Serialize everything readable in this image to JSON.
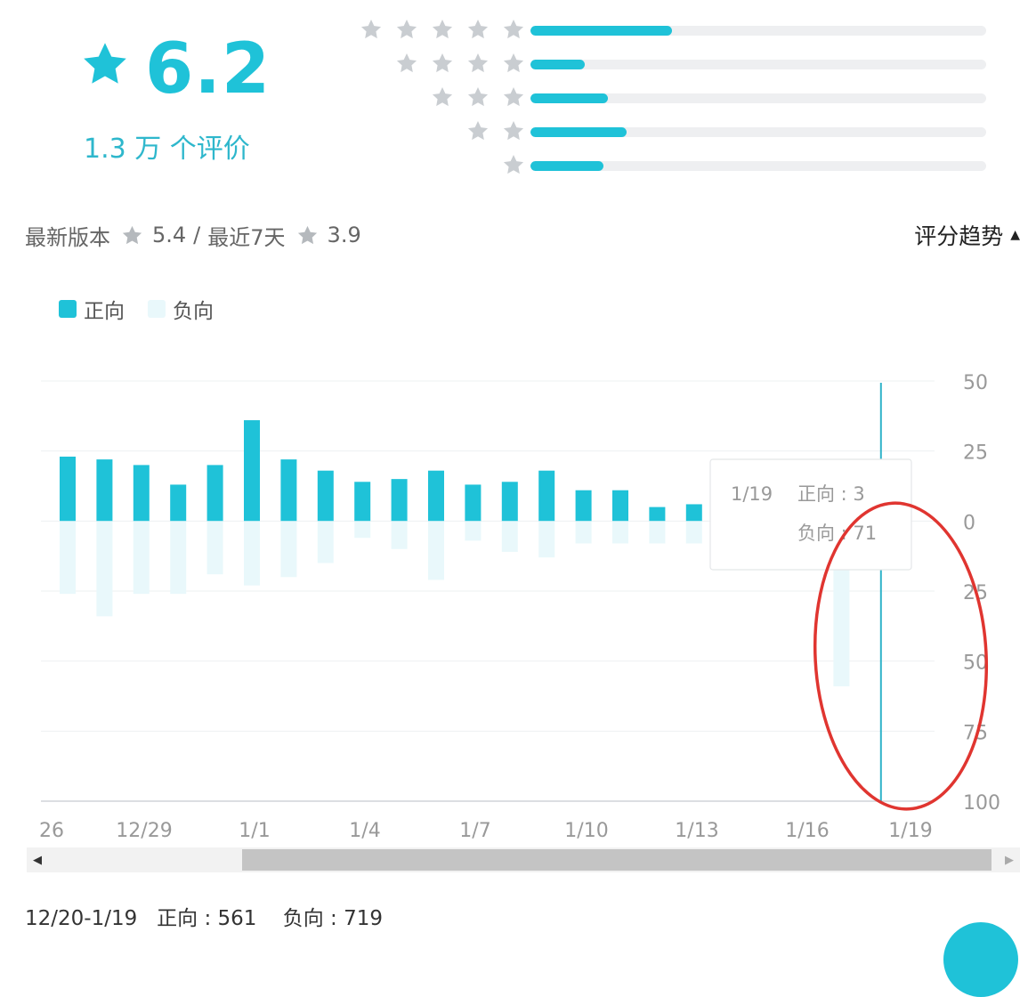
{
  "rating": {
    "score": "6.2",
    "review_count": "1.3 万 个评价",
    "distribution": [
      {
        "stars": 5,
        "fraction": 0.31
      },
      {
        "stars": 4,
        "fraction": 0.12
      },
      {
        "stars": 3,
        "fraction": 0.17
      },
      {
        "stars": 2,
        "fraction": 0.21
      },
      {
        "stars": 1,
        "fraction": 0.16
      }
    ]
  },
  "colors": {
    "accent": "#1fc2d8",
    "negative": "#e9f8fb",
    "star_gray": "#c9cdd1",
    "track": "#eeeff1",
    "annotation": "#e03530"
  },
  "version_info": {
    "latest_label": "最新版本",
    "latest_score": "5.4",
    "separator": "/",
    "recent_label": "最近7天",
    "recent_score": "3.9"
  },
  "trend_toggle": {
    "label": "评分趋势",
    "icon": "caret-up-icon"
  },
  "legend": {
    "positive": "正向",
    "negative": "负向"
  },
  "chart_data": {
    "type": "bar",
    "x_tick_labels": [
      "26",
      "12/29",
      "1/1",
      "1/4",
      "1/7",
      "1/10",
      "1/13",
      "1/16",
      "1/19"
    ],
    "y_tick_labels": [
      "50",
      "25",
      "0",
      "25",
      "50",
      "75",
      "100"
    ],
    "ylim": [
      -100,
      50
    ],
    "series": [
      {
        "name": "正向",
        "values": [
          23,
          22,
          20,
          13,
          20,
          36,
          22,
          18,
          14,
          15,
          18,
          13,
          14,
          18,
          11,
          11,
          5,
          6,
          null,
          null,
          null,
          null,
          3
        ]
      },
      {
        "name": "负向",
        "values": [
          26,
          34,
          26,
          26,
          19,
          23,
          20,
          15,
          6,
          10,
          21,
          7,
          11,
          13,
          8,
          8,
          8,
          8,
          null,
          null,
          null,
          59,
          71
        ]
      }
    ],
    "tooltip": {
      "date": "1/19",
      "positive": "正向 : 3",
      "negative": "负向 : 71"
    },
    "grid": true
  },
  "scrollbar": {
    "left_icon": "◀",
    "right_icon": "▶"
  },
  "summary": {
    "range": "12/20-1/19",
    "positive": "正向 : 561",
    "negative": "负向 : 719"
  }
}
